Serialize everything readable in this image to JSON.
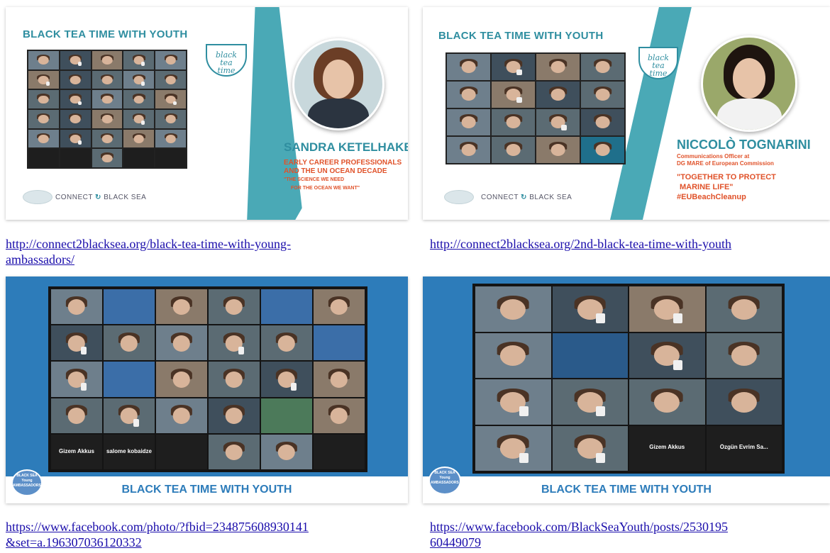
{
  "panels": {
    "p1": {
      "title": "BLACK TEA TIME WITH YOUTH",
      "logo": "black tea time",
      "speaker_name": "SANDRA KETELHAKE",
      "line1": "EARLY CAREER PROFESSIONALS",
      "line2": "AND THE UN OCEAN DECADE",
      "line3": "\"THE SCIENCE WE NEED",
      "line4": "FOR THE OCEAN WE WANT\"",
      "brand_left": "CONNECT",
      "brand_right": "BLACK SEA",
      "link": "http://connect2blacksea.org/black-tea-time-with-young-\nambassadors/"
    },
    "p2": {
      "title": "BLACK TEA TIME WITH YOUTH",
      "logo": "black tea time",
      "speaker_name": "NICCOLÒ TOGNARINI",
      "role1": "Communications Officer at",
      "role2": "DG MARE of European Commission",
      "quote1": "\"TOGETHER TO PROTECT",
      "quote2": "MARINE LIFE\"",
      "hashtag": "#EUBeachCleanup",
      "brand_left": "CONNECT",
      "brand_right": "BLACK SEA",
      "link": "http://connect2blacksea.org/2nd-black-tea-time-with-youth"
    },
    "p3": {
      "tile_name_1": "Gizem Akkus",
      "tile_name_2": "salome kobaidze",
      "badge": "BLACK SEA Young AMBASSADORS",
      "footer_title": "BLACK TEA TIME WITH YOUTH",
      "link": "https://www.facebook.com/photo/?fbid=234875608930141\n&set=a.196307036120332"
    },
    "p4": {
      "tile_name_1": "Gizem Akkus",
      "tile_name_2": "Özgün Evrim Sa...",
      "badge": "BLACK SEA Young AMBASSADORS",
      "footer_title": "BLACK TEA TIME WITH YOUTH",
      "link": "https://www.facebook.com/BlackSeaYouth/posts/2530195\n60449079"
    }
  },
  "colors": {
    "teal": "#4aa9b6",
    "teal_dark": "#2f8ea0",
    "orange": "#e0522a",
    "blue": "#2d7cba",
    "link": "#1a0dab"
  },
  "icons": [
    "tea-cup-icon",
    "connect-wave-icon",
    "black-sea-map-icon",
    "ambassadors-badge-icon"
  ]
}
